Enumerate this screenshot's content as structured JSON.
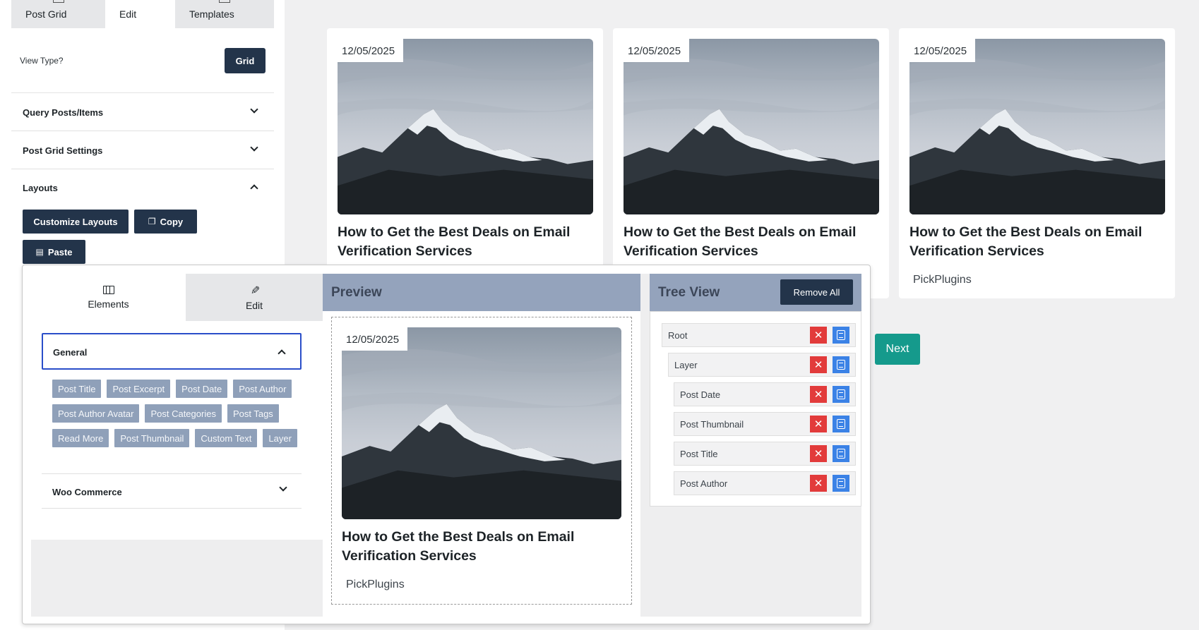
{
  "sidebar": {
    "tabs": [
      {
        "label": "Post Grid"
      },
      {
        "label": "Edit"
      },
      {
        "label": "Templates"
      }
    ],
    "view_type_label": "View Type?",
    "view_type_value": "Grid",
    "sections": {
      "query": "Query Posts/Items",
      "settings": "Post Grid Settings",
      "layouts": "Layouts"
    },
    "buttons": {
      "customize": "Customize Layouts",
      "copy": "Copy",
      "paste": "Paste"
    }
  },
  "posts": [
    {
      "date": "12/05/2025",
      "title": "How to Get the Best Deals on Email Verification Services",
      "author": ""
    },
    {
      "date": "12/05/2025",
      "title": "How to Get the Best Deals on Email Verification Services",
      "author": ""
    },
    {
      "date": "12/05/2025",
      "title": "How to Get the Best Deals on Email Verification Services",
      "author": "PickPlugins"
    }
  ],
  "pagination": {
    "next": "Next"
  },
  "editor": {
    "tabs": {
      "elements": "Elements",
      "edit": "Edit"
    },
    "general_label": "General",
    "elements": [
      "Post Title",
      "Post Excerpt",
      "Post Date",
      "Post Author",
      "Post Author Avatar",
      "Post Categories",
      "Post Tags",
      "Read More",
      "Post Thumbnail",
      "Custom Text",
      "Layer"
    ],
    "woo_label": "Woo Commerce",
    "preview": {
      "title": "Preview",
      "date": "12/05/2025",
      "post_title": "How to Get the Best Deals on Email Verification Services",
      "author": "PickPlugins"
    },
    "tree": {
      "title": "Tree View",
      "remove_all": "Remove All",
      "nodes": [
        "Root",
        "Layer",
        "Post Date",
        "Post Thumbnail",
        "Post Title",
        "Post Author"
      ]
    }
  },
  "colors": {
    "dark_button": "#23344a",
    "next_button": "#159a8c",
    "panel_header": "#94a3bc",
    "chip": "#8fa0b9",
    "delete": "#e23b3b",
    "copy": "#3b82e6",
    "focus_border": "#2a4ec9"
  }
}
